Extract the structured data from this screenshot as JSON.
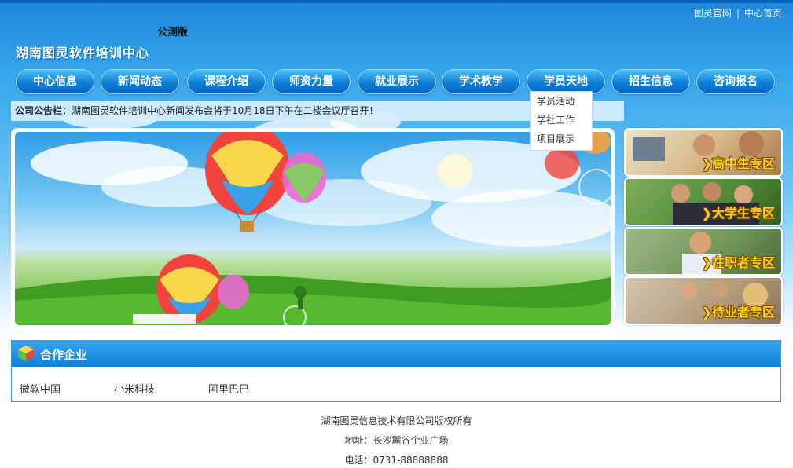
{
  "toplinks": {
    "official": "图灵官网",
    "separator": "|",
    "home": "中心首页"
  },
  "header": {
    "beta": "公测版",
    "title": "湖南图灵软件培训中心"
  },
  "nav": {
    "items": [
      "中心信息",
      "新闻动态",
      "课程介绍",
      "师资力量",
      "就业展示",
      "学术教学",
      "学员天地",
      "招生信息",
      "咨询报名"
    ],
    "active": "学员天地"
  },
  "dropdown": {
    "items": [
      "学员活动",
      "学社工作",
      "项目展示"
    ]
  },
  "notice": {
    "label": "公司公告栏：",
    "text": "湖南图灵软件培训中心新闻发布会将于10月18日下午在二楼会议厅召开！"
  },
  "zones": [
    {
      "label": "高中生专区",
      "icon": "chevron-right-icon"
    },
    {
      "label": "大学生专区",
      "icon": "chevron-right-icon"
    },
    {
      "label": "在职者专区",
      "icon": "chevron-right-icon"
    },
    {
      "label": "待业者专区",
      "icon": "chevron-right-icon"
    }
  ],
  "partners": {
    "title": "合作企业",
    "items": [
      "微软中国",
      "小米科技",
      "阿里巴巴"
    ]
  },
  "footer": {
    "copyright": "湖南图灵信息技术有限公司版权所有",
    "address": "地址：长沙麓谷企业广场",
    "phone": "电话：0731-88888888"
  },
  "colors": {
    "nav": "#0c7fd6",
    "zone_label": "#ffd21a",
    "header_bar": "#1f86d9"
  }
}
